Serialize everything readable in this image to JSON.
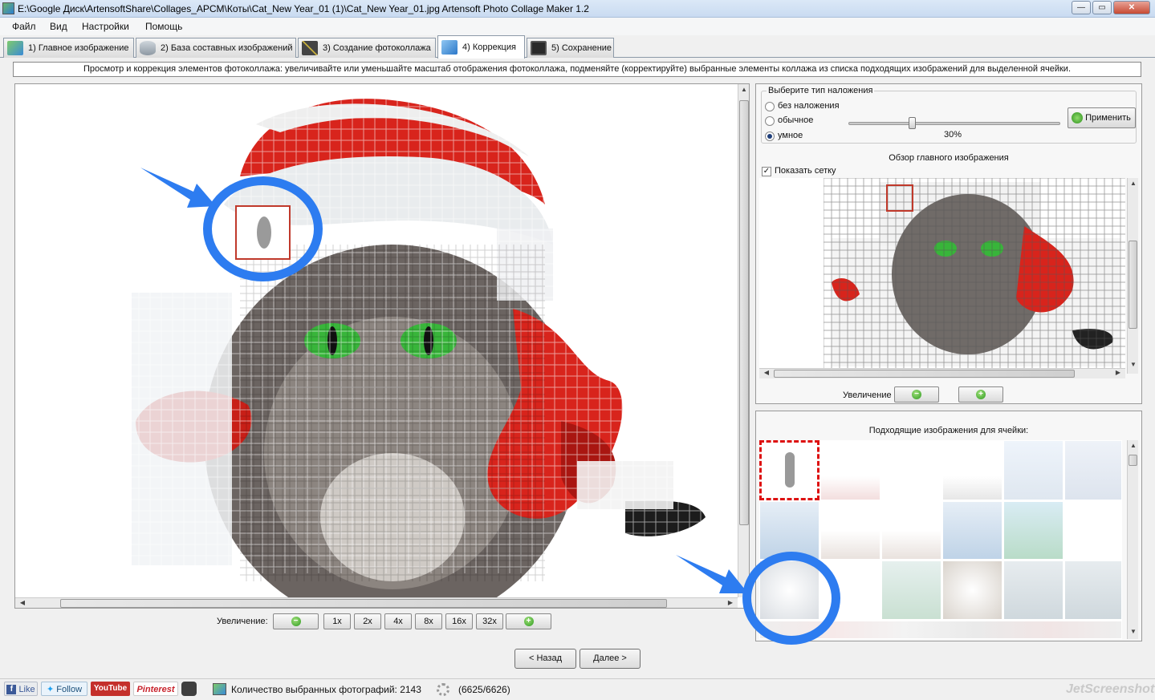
{
  "window": {
    "title": "E:\\Google Диск\\ArtensoftShare\\Collages_APCM\\Коты\\Cat_New Year_01 (1)\\Cat_New Year_01.jpg Artensoft Photo Collage Maker 1.2"
  },
  "menu": [
    "Файл",
    "Вид",
    "Настройки",
    "Помощь"
  ],
  "tabs": [
    {
      "label": "1) Главное изображение",
      "icon": "image-icon"
    },
    {
      "label": "2) База составных изображений",
      "icon": "database-icon"
    },
    {
      "label": "3) Создание фотоколлажа",
      "icon": "magic-wand-icon"
    },
    {
      "label": "4) Коррекция",
      "icon": "cubes-icon",
      "active": true
    },
    {
      "label": "5) Сохранение",
      "icon": "floppy-disk-icon"
    }
  ],
  "info_text": "Просмотр и коррекция элементов фотоколлажа: увеличивайте или уменьшайте масштаб отображения фотоколлажа, подменяйте (корректируйте) выбранные элементы коллажа из списка подходящих изображений для выделенной ячейки.",
  "main_zoom": {
    "label": "Увеличение:",
    "buttons": [
      "1x",
      "2x",
      "4x",
      "8x",
      "16x",
      "32x"
    ],
    "minus": "−",
    "plus": "+"
  },
  "overlay": {
    "legend": "Выберите тип наложения",
    "options": [
      "без наложения",
      "обычное",
      "умное"
    ],
    "selected": "умное",
    "slider_value": "30%",
    "slider_fraction": 0.3,
    "apply_label": "Применить"
  },
  "preview": {
    "title": "Обзор главного изображения",
    "show_grid_label": "Показать сетку",
    "show_grid": true,
    "zoom_label": "Увеличение",
    "minus": "−",
    "plus": "+"
  },
  "suitable": {
    "title": "Подходящие изображения для ячейки:"
  },
  "nav": {
    "back": "< Назад",
    "next": "Далее >"
  },
  "status": {
    "like": "Like",
    "follow": "Follow",
    "youtube": "YouTube",
    "pinterest": "Pinterest",
    "count_text": "Количество выбранных фотографий: 2143",
    "progress_text": "(6625/6626)",
    "watermark": "JetScreenshot"
  },
  "colors": {
    "accent_blue": "#2d7cf0",
    "hat_red": "#d8241c",
    "eye_green": "#38b53a",
    "selection_red": "#c0392b"
  }
}
